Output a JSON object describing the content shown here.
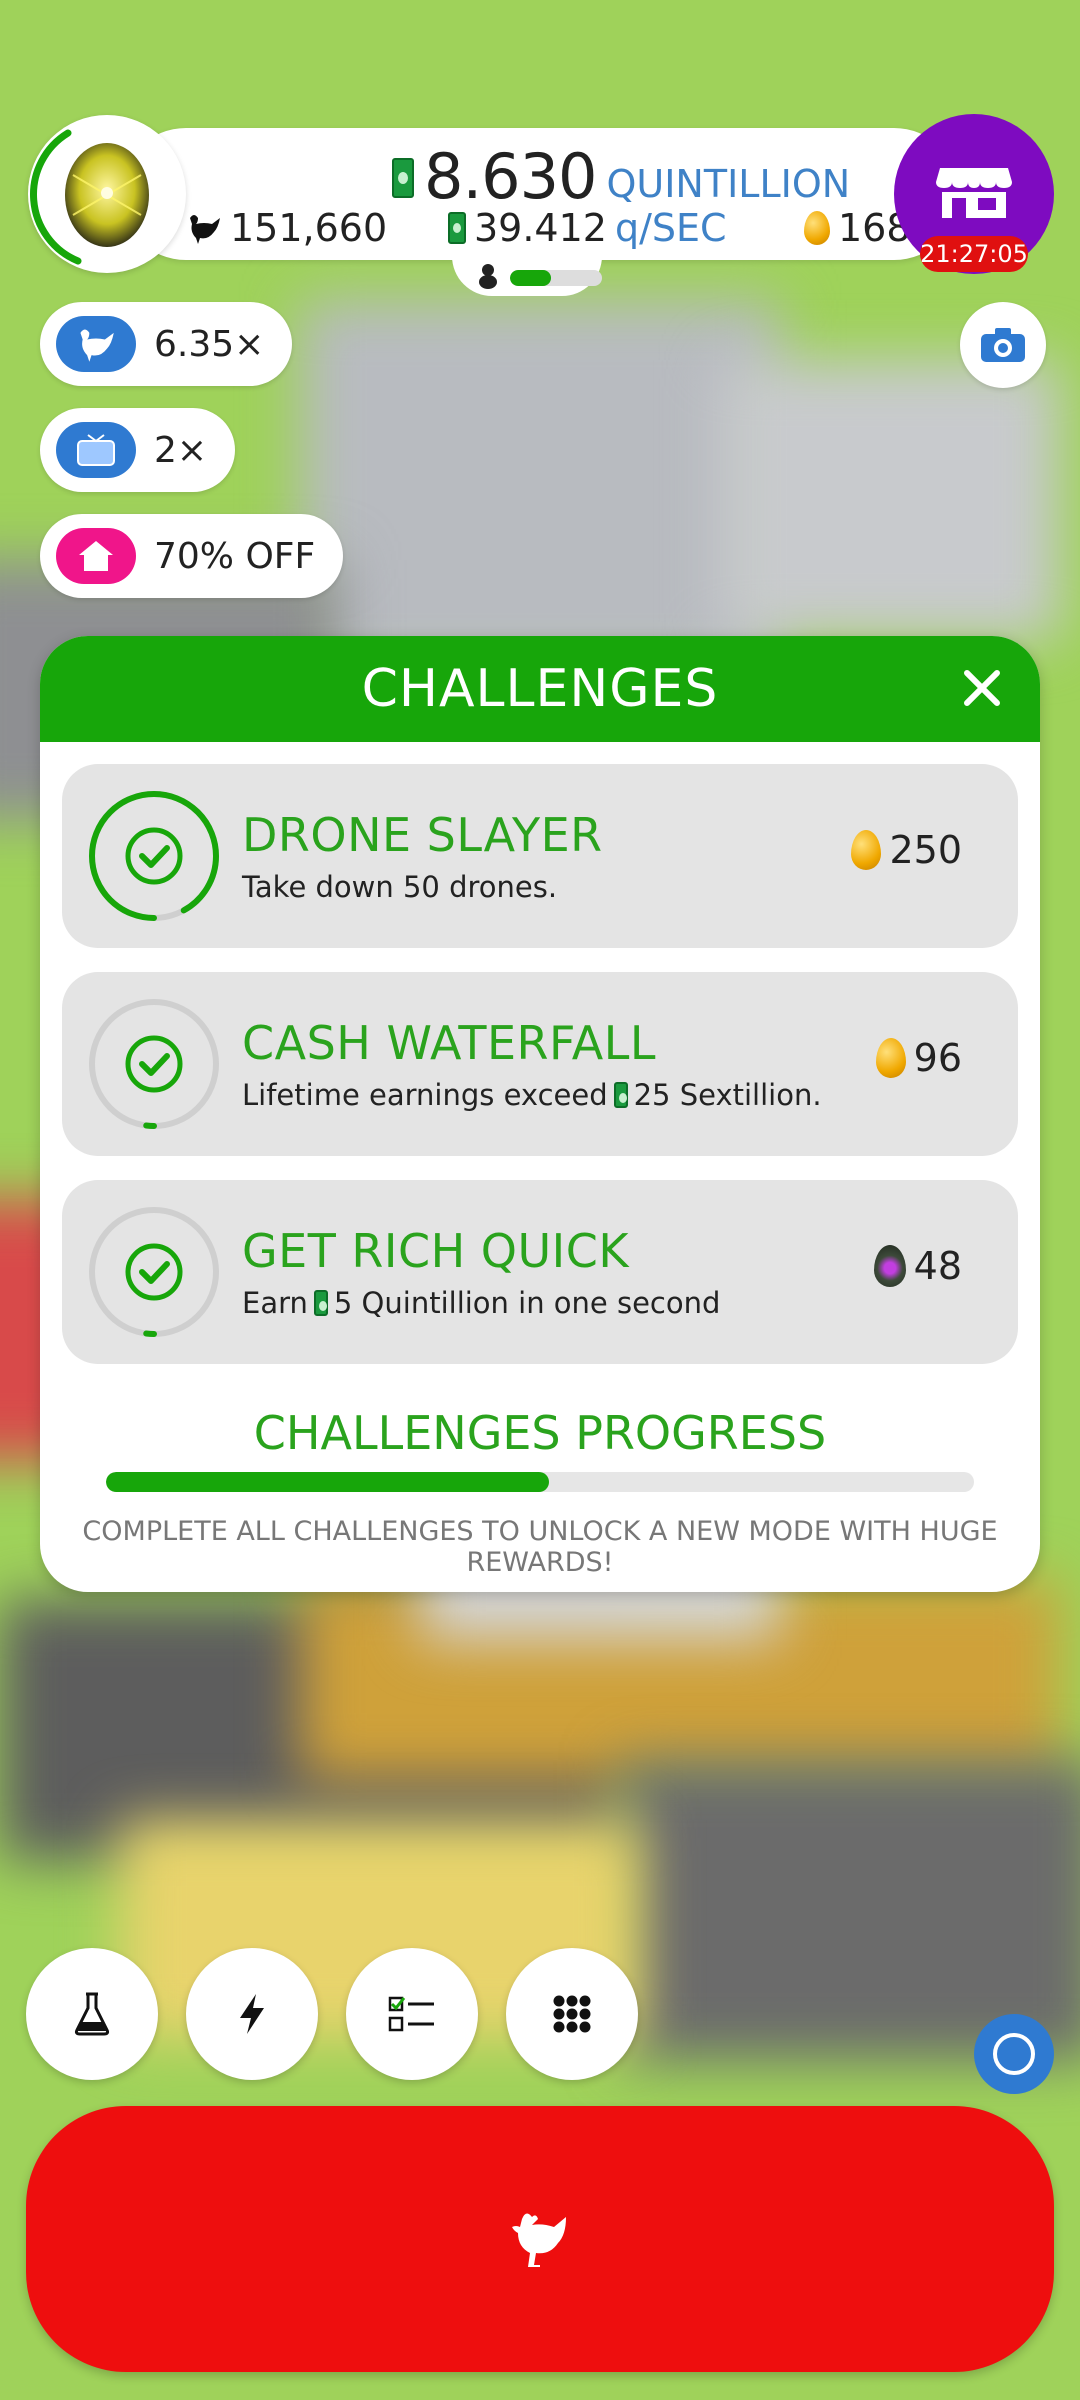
{
  "hud": {
    "cash_value": "8.630",
    "cash_unit": "QUINTILLION",
    "chickens": "151,660",
    "rate_value": "39.412",
    "rate_unit": "q/SEC",
    "golden_eggs": "168",
    "hatchery_fill": 0.45,
    "shop_timer": "21:27:05"
  },
  "boosts": [
    {
      "label": "6.35×",
      "color": "#2f7ad1",
      "icon": "chicken-icon"
    },
    {
      "label": "2×",
      "color": "#2f7ad1",
      "icon": "tv-icon"
    },
    {
      "label": "70% OFF",
      "color": "#f0158a",
      "icon": "house-icon"
    }
  ],
  "challenges": {
    "title": "CHALLENGES",
    "items": [
      {
        "title": "DRONE SLAYER",
        "desc": "Take down 50 drones.",
        "reward": "250",
        "reward_type": "golden-egg",
        "progress": 0.92
      },
      {
        "title": "CASH WATERFALL",
        "desc_before": "Lifetime earnings exceed",
        "desc_after": "25 Sextillion.",
        "reward": "96",
        "reward_type": "golden-egg",
        "progress": 0.02
      },
      {
        "title": "GET RICH QUICK",
        "desc_before": "Earn",
        "desc_after": "5 Quintillion in one second",
        "reward": "48",
        "reward_type": "soul-egg",
        "progress": 0.02
      }
    ],
    "progress_title": "CHALLENGES PROGRESS",
    "progress_fraction": 0.51,
    "progress_note": "COMPLETE ALL CHALLENGES TO UNLOCK A NEW MODE WITH HUGE REWARDS!"
  },
  "bottom_icons": [
    "flask-icon",
    "lightning-icon",
    "checklist-icon",
    "grid-icon"
  ],
  "colors": {
    "accent_green": "#17a60a",
    "text_green": "#2aa31d",
    "hatch_red": "#ee0e0e",
    "shop_purple": "#7e0bc0"
  }
}
